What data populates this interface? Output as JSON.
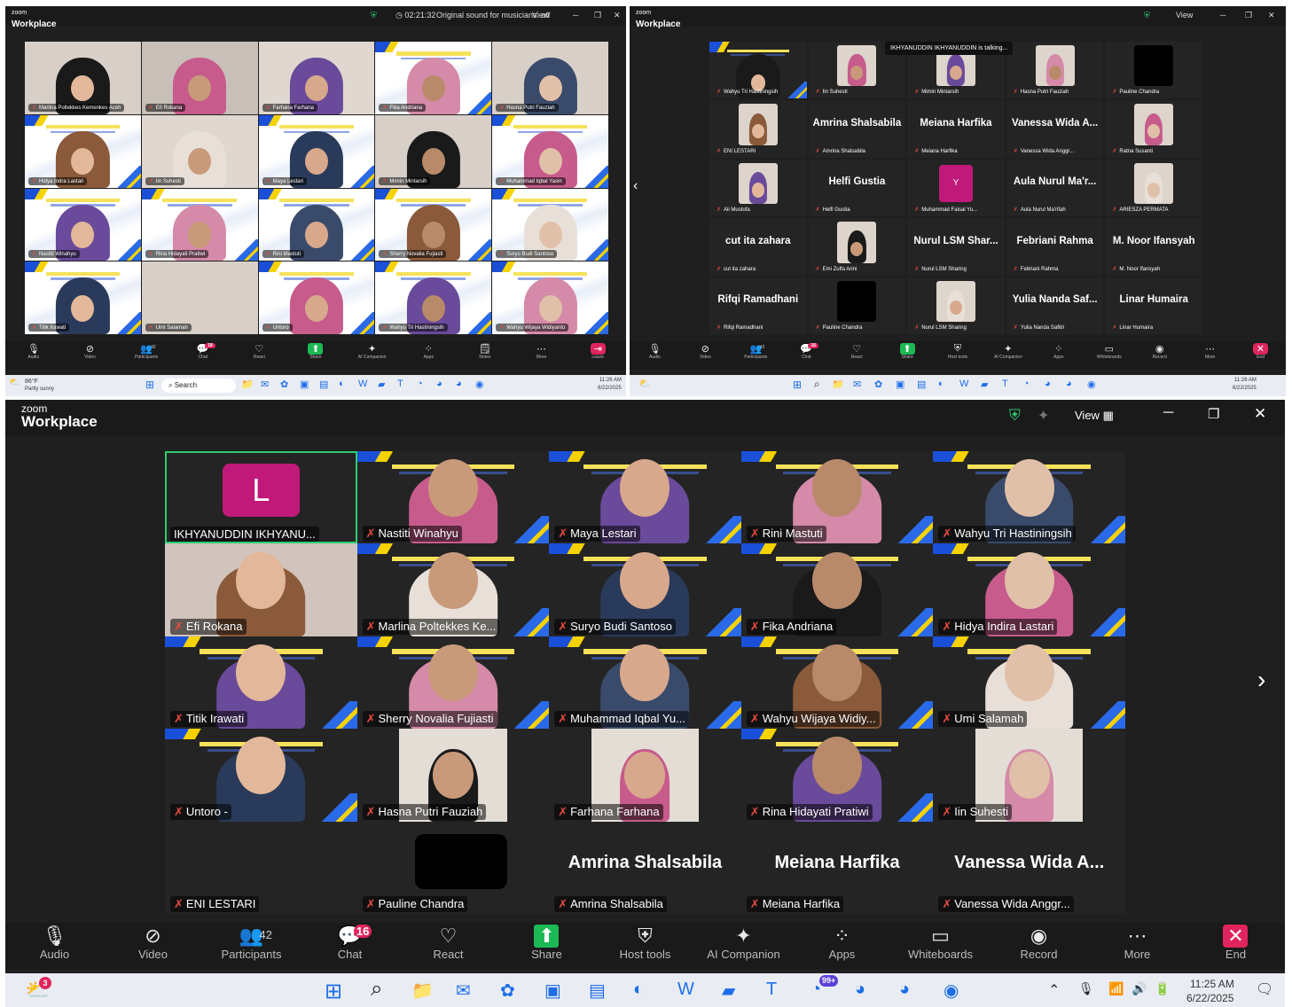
{
  "app": {
    "logo_small": "zoom",
    "logo_big": "Workplace"
  },
  "w1": {
    "status": "◷ 02:21:32",
    "sound": "Original sound for musicians: off",
    "view": "View",
    "tiles": [
      "Marlina Poltekkes Kemenkes Aceh",
      "Efi Rokana",
      "Farhana Farhana",
      "Fika Andriana",
      "Hasna Putri Fauziah",
      "Hidya Indra Lastari",
      "Iin Suhesti",
      "Maya Lestari",
      "Mimin Mintarsih",
      "Muhammad Iqbal Yasin",
      "Nastiti Winahyu",
      "Rina Hidayati Pratiwi",
      "Rini Mastuti",
      "Sherry Novalia Fujiasti",
      "Suryo Budi Santoso",
      "Titik Irawati",
      "Umi Salamah",
      "Untoro",
      "Wahyu Tri Hastiningsih",
      "Wahyu Wijaya Widiyanto"
    ],
    "toolbar": [
      "Audio",
      "Video",
      "Participants",
      "Chat",
      "React",
      "Share",
      "AI Companion",
      "Apps",
      "Notes",
      "More",
      "Leave"
    ],
    "participants_count": "42",
    "chat_badge": "18",
    "weather_temp": "86°F",
    "weather_desc": "Partly sunny",
    "search": "Search",
    "time": "11:26 AM",
    "date": "6/22/2025"
  },
  "w2": {
    "view": "View",
    "talking": "IKHYANUDDIN IKHYANUDDIN is talking...",
    "cells": [
      {
        "big": "",
        "label": "Wahyu Tri Hastiningsih",
        "kind": "slide"
      },
      {
        "big": "",
        "label": "Iin Suhesti",
        "kind": "photo"
      },
      {
        "big": "",
        "label": "Mimin Mintarsih",
        "kind": "photo"
      },
      {
        "big": "",
        "label": "Hasna Putri Fauziah",
        "kind": "photo"
      },
      {
        "big": "",
        "label": "Pauline Chandra",
        "kind": "black"
      },
      {
        "big": "",
        "label": "ENI LESTARI",
        "kind": "photo"
      },
      {
        "big": "Amrina Shalsabila",
        "label": "Amrina Shalsabila",
        "kind": "text"
      },
      {
        "big": "Meiana Harfika",
        "label": "Meiana Harfika",
        "kind": "text"
      },
      {
        "big": "Vanessa Wida A...",
        "label": "Vanessa Wida Anggr...",
        "kind": "text"
      },
      {
        "big": "",
        "label": "Ratna Susanti",
        "kind": "photo"
      },
      {
        "big": "",
        "label": "Ali Mustofa",
        "kind": "photo"
      },
      {
        "big": "Helfi Gustia",
        "label": "Helfi Gustia",
        "kind": "text"
      },
      {
        "big": "Y",
        "label": "Muhammad Faisal Yu...",
        "kind": "avatar"
      },
      {
        "big": "Aula Nurul Ma'r...",
        "label": "Aula Nurul Ma'rifah",
        "kind": "text"
      },
      {
        "big": "",
        "label": "ARIESZA PERMATA",
        "kind": "photo"
      },
      {
        "big": "cut ita zahara",
        "label": "cut ita zahara",
        "kind": "text"
      },
      {
        "big": "",
        "label": "Emi Zulfa Arini",
        "kind": "photo"
      },
      {
        "big": "Nurul LSM Shar...",
        "label": "Nurul LSM Sharing",
        "kind": "text"
      },
      {
        "big": "Febriani Rahma",
        "label": "Febriani Rahma",
        "kind": "text"
      },
      {
        "big": "M. Noor Ifansyah",
        "label": "M. Noor Ifansyah",
        "kind": "text"
      },
      {
        "big": "Rifqi Ramadhani",
        "label": "Rifqi Ramadhani",
        "kind": "text"
      },
      {
        "big": "",
        "label": "Pauline Chandra",
        "kind": "black"
      },
      {
        "big": "",
        "label": "Nurul LSM Sharing",
        "kind": "photo"
      },
      {
        "big": "Yulia Nanda Saf...",
        "label": "Yulia Nanda Safitri",
        "kind": "text"
      },
      {
        "big": "Linar Humaira",
        "label": "Linar Humaira",
        "kind": "text"
      }
    ],
    "toolbar": [
      "Audio",
      "Video",
      "Participants",
      "Chat",
      "React",
      "Share",
      "Host tools",
      "AI Companion",
      "Apps",
      "Whiteboards",
      "Record",
      "More",
      "End"
    ],
    "participants_count": "42",
    "chat_badge": "16",
    "time": "11:26 AM",
    "date": "6/22/2025"
  },
  "w3": {
    "view": "View",
    "tiles": [
      {
        "name": "IKHYANUDDIN IKHYANU...",
        "kind": "avatar",
        "letter": "L",
        "mic": false
      },
      {
        "name": "Nastiti Winahyu",
        "kind": "slide",
        "mic": true
      },
      {
        "name": "Maya Lestari",
        "kind": "slide",
        "mic": true
      },
      {
        "name": "Rini Mastuti",
        "kind": "slide",
        "mic": true
      },
      {
        "name": "Wahyu Tri Hastiningsih",
        "kind": "slide",
        "mic": true
      },
      {
        "name": "Efi Rokana",
        "kind": "photo",
        "mic": true
      },
      {
        "name": "Marlina Poltekkes Ke...",
        "kind": "slide",
        "mic": true
      },
      {
        "name": "Suryo Budi Santoso",
        "kind": "slide",
        "mic": true
      },
      {
        "name": "Fika Andriana",
        "kind": "slide",
        "mic": true
      },
      {
        "name": "Hidya Indira Lastari",
        "kind": "slide",
        "mic": true
      },
      {
        "name": "Titik Irawati",
        "kind": "slide",
        "mic": true
      },
      {
        "name": "Sherry Novalia Fujiasti",
        "kind": "slide",
        "mic": true
      },
      {
        "name": "Muhammad Iqbal Yu...",
        "kind": "slide",
        "mic": true
      },
      {
        "name": "Wahyu Wijaya Widiy...",
        "kind": "slide",
        "mic": true
      },
      {
        "name": "Umi Salamah",
        "kind": "slide",
        "mic": true
      },
      {
        "name": "Untoro -",
        "kind": "slide",
        "mic": true
      },
      {
        "name": "Hasna Putri Fauziah",
        "kind": "photo",
        "mic": true
      },
      {
        "name": "Farhana Farhana",
        "kind": "photo",
        "mic": true
      },
      {
        "name": "Rina Hidayati Pratiwi",
        "kind": "slide",
        "mic": true
      },
      {
        "name": "Iin Suhesti",
        "kind": "photo",
        "mic": true
      },
      {
        "name": "ENI LESTARI",
        "kind": "black",
        "mic": true
      },
      {
        "name": "Pauline Chandra",
        "kind": "black",
        "mic": true
      },
      {
        "name": "Amrina Shalsabila",
        "kind": "text",
        "big": "Amrina Shalsabila",
        "mic": true
      },
      {
        "name": "Meiana Harfika",
        "kind": "text",
        "big": "Meiana Harfika",
        "mic": true
      },
      {
        "name": "Vanessa Wida Anggr...",
        "kind": "text",
        "big": "Vanessa Wida A...",
        "mic": true
      }
    ],
    "toolbar": [
      "Audio",
      "Video",
      "Participants",
      "Chat",
      "React",
      "Share",
      "Host tools",
      "AI Companion",
      "Apps",
      "Whiteboards",
      "Record",
      "More",
      "End"
    ],
    "participants_count": "42",
    "chat_badge": "16",
    "time": "11:25 AM",
    "date": "6/22/2025",
    "tray_badge": "99+",
    "weather_badge": "3"
  }
}
